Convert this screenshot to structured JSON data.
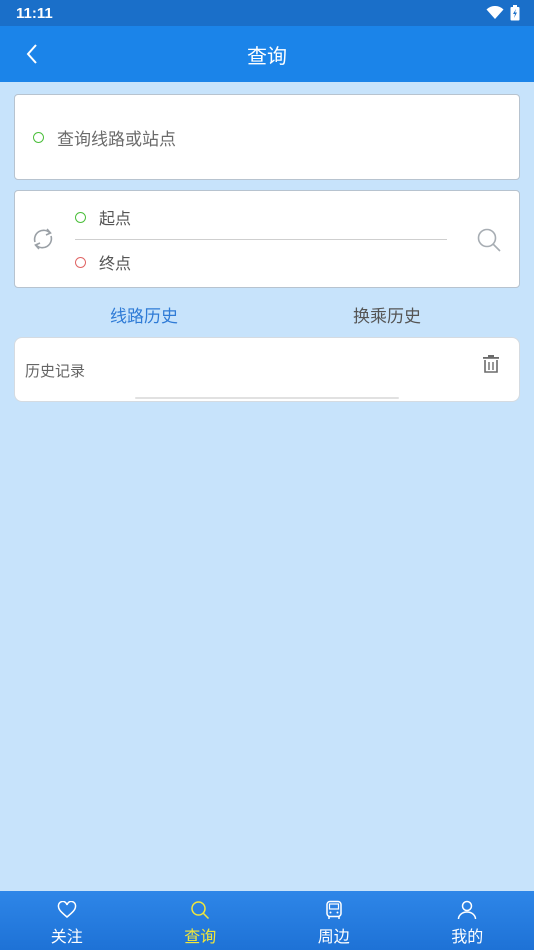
{
  "status_bar": {
    "time": "11:11",
    "icons": [
      "wifi-icon",
      "battery-charging-icon"
    ]
  },
  "header": {
    "title": "查询",
    "back_icon": "chevron-left-icon"
  },
  "line_search": {
    "placeholder": "查询线路或站点"
  },
  "route_search": {
    "start_placeholder": "起点",
    "end_placeholder": "终点",
    "swap_icon": "swap-arrows-icon",
    "search_icon": "search-icon"
  },
  "tabs": [
    {
      "label": "线路历史",
      "active": true
    },
    {
      "label": "换乘历史",
      "active": false
    }
  ],
  "history": {
    "title": "历史记录",
    "trash_icon": "trash-icon"
  },
  "bottom_nav": [
    {
      "label": "关注",
      "icon": "heart-icon",
      "active": false
    },
    {
      "label": "查询",
      "icon": "search-icon",
      "active": true
    },
    {
      "label": "周边",
      "icon": "bus-icon",
      "active": false
    },
    {
      "label": "我的",
      "icon": "person-icon",
      "active": false
    }
  ],
  "colors": {
    "status_bar": "#1a6fc9",
    "app_bar": "#1b84e9",
    "background": "#c7e3fb",
    "active_tab": "#2f7bd6",
    "nav_active": "#f2e73a",
    "start_dot": "#4cbf3c",
    "end_dot": "#e06565"
  }
}
